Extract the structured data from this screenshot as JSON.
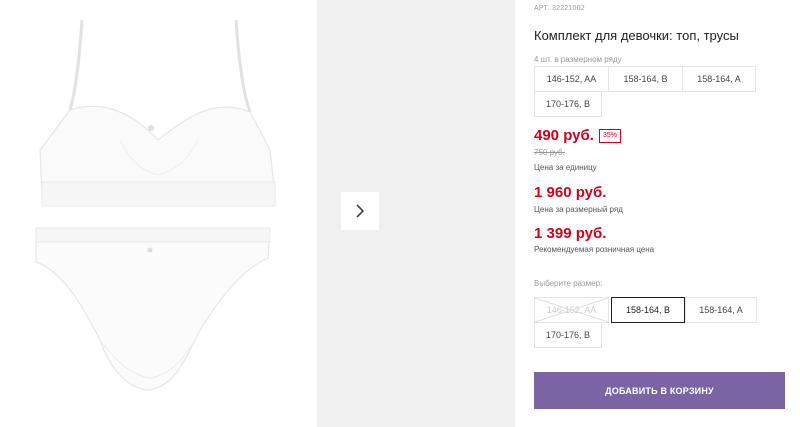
{
  "product": {
    "sku_label": "АРТ:",
    "sku": "32221002",
    "title": "Комплект для девочки: топ, трусы",
    "pack_note": "4 шт. в размерном ряду",
    "size_ranges": [
      "146-152, AA",
      "158-164, B",
      "158-164, A",
      "170-176, B"
    ]
  },
  "pricing": {
    "unit_price": "490 руб.",
    "discount": "35%",
    "old_price": "750 руб.",
    "unit_note": "Цена за единицу",
    "range_price": "1 960 руб.",
    "range_note": "Цена за размерный ряд",
    "retail_price": "1 399 руб.",
    "retail_note": "Рекомендуемая розничная цена"
  },
  "size_picker": {
    "label": "Выберите размер:",
    "options": [
      {
        "label": "146-152, AA",
        "state": "unavailable"
      },
      {
        "label": "158-164, B",
        "state": "selected"
      },
      {
        "label": "158-164, A",
        "state": "available"
      },
      {
        "label": "170-176, B",
        "state": "available"
      }
    ]
  },
  "actions": {
    "add_to_cart": "ДОБАВИТЬ В КОРЗИНУ"
  },
  "colors": {
    "price_red": "#d0021b",
    "accent_purple": "#7a64a4"
  },
  "icons": {
    "next": "chevron-right-icon"
  }
}
